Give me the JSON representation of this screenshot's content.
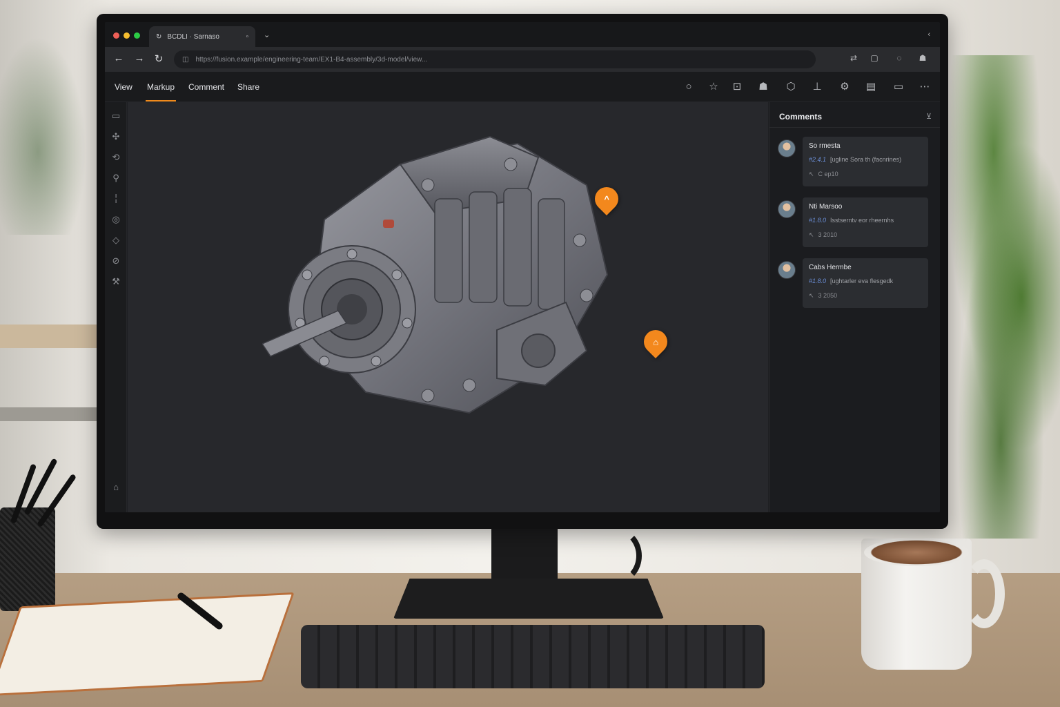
{
  "browser": {
    "tab_title": "BCDLI · Sarnaso",
    "url": "https://fusion.example/engineering-team/EX1-B4-assembly/3d-model/view...",
    "traffic_colors": [
      "#ed5f57",
      "#f5bd2f",
      "#2ccb45"
    ]
  },
  "app": {
    "menu": [
      {
        "label": "View"
      },
      {
        "label": "Markup"
      },
      {
        "label": "Comment"
      },
      {
        "label": "Share"
      }
    ],
    "active_menu": "Markup",
    "accent_color": "#f08a1c"
  },
  "comments": {
    "title": "Comments",
    "items": [
      {
        "author": "So rmesta",
        "ref": "#2.4.1",
        "body": "[ugline Sora th (facnrines)",
        "meta": "C ep10"
      },
      {
        "author": "Nti Marsoo",
        "ref": "#1.8.0",
        "body": "Isstserntv eor rheernhs",
        "meta": "3 2010"
      },
      {
        "author": "Cabs Hermbe",
        "ref": "#1.8.0",
        "body": "[ughtarler eva flesgedk",
        "meta": "3 2050"
      }
    ]
  },
  "viewport": {
    "markers": [
      {
        "symbol": "^"
      },
      {
        "symbol": "⌂"
      }
    ]
  }
}
